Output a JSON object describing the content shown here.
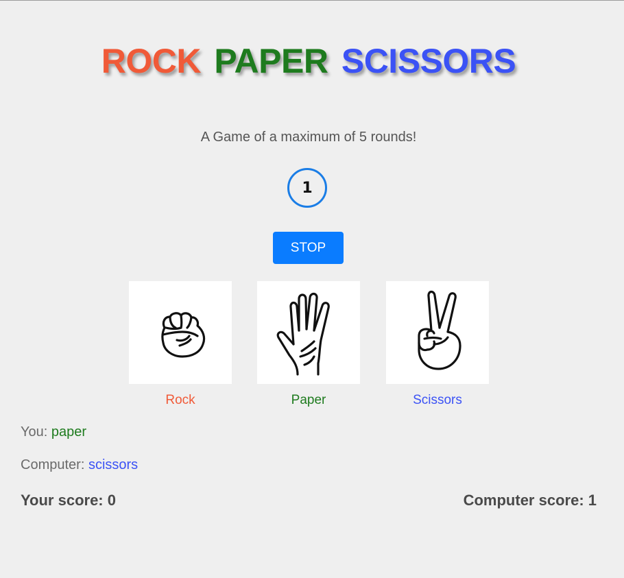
{
  "title": {
    "rock": "ROCK",
    "paper": "PAPER",
    "scissors": "SCISSORS"
  },
  "subtitle": "A Game of a maximum of 5 rounds!",
  "round": "1",
  "stop_button": "STOP",
  "choices": [
    {
      "label": "Rock",
      "icon": "fist-icon",
      "color": "#f05a38"
    },
    {
      "label": "Paper",
      "icon": "open-hand-icon",
      "color": "#1e7b1e"
    },
    {
      "label": "Scissors",
      "icon": "peace-hand-icon",
      "color": "#3b52f5"
    }
  ],
  "result": {
    "you_label": "You:",
    "you_value": "paper",
    "computer_label": "Computer:",
    "computer_value": "scissors"
  },
  "scores": {
    "your_score": "Your score: 0",
    "computer_score": "Computer score: 1"
  },
  "colors": {
    "background": "#efefef",
    "rock": "#f05a38",
    "paper": "#1e7b1e",
    "scissors": "#3b52f5",
    "accent": "#0a7cff"
  }
}
